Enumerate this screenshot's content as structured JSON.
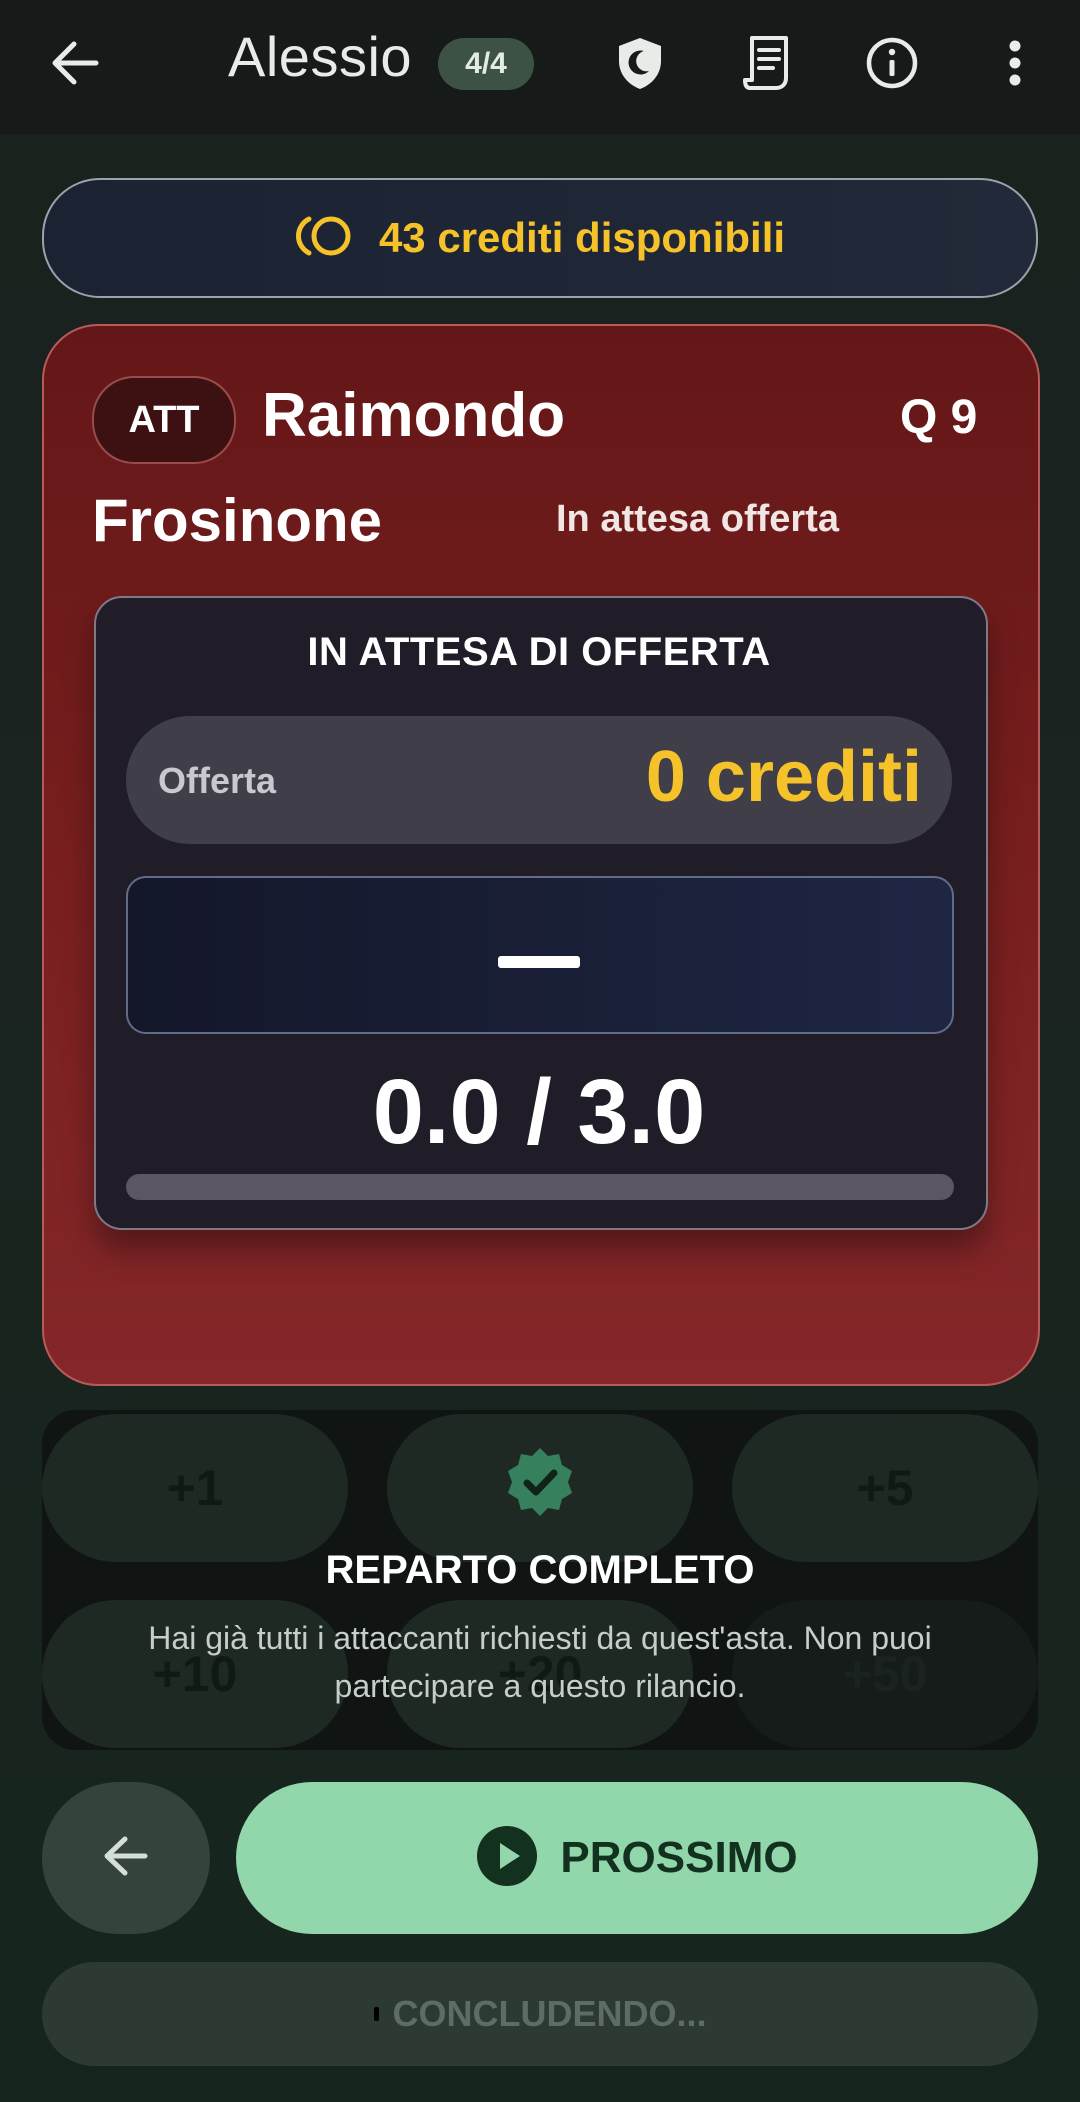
{
  "header": {
    "title": "Alessio",
    "round_badge": "4/4",
    "icons": [
      "back-arrow-icon",
      "shield-moon-icon",
      "receipt-icon",
      "info-icon",
      "more-vertical-icon"
    ]
  },
  "credits": {
    "text": "43 crediti disponibili",
    "icon": "coins-icon",
    "color": "#f6c22a"
  },
  "player": {
    "role": "ATT",
    "name": "Raimondo",
    "quote": "Q 9",
    "team": "Frosinone",
    "status": "In attesa offerta",
    "card_color": "#7a1f1f"
  },
  "auction": {
    "header": "IN ATTESA DI OFFERTA",
    "offer_label": "Offerta",
    "offer_value": "0 crediti",
    "bidder": "—",
    "timer_text": "0.0 / 3.0",
    "timer_progress": 0.0
  },
  "raise": {
    "buttons": [
      "+1",
      "+5",
      "+10",
      "+20",
      "+50"
    ],
    "overlay_icon": "verified-badge-icon",
    "overlay_title": "REPARTO COMPLETO",
    "overlay_message": "Hai già tutti i attaccanti richiesti da quest'asta. Non puoi partecipare a questo rilancio."
  },
  "footer": {
    "next_label": "PROSSIMO",
    "concluding_label": "CONCLUDENDO...",
    "accent": "#92d6ab"
  }
}
